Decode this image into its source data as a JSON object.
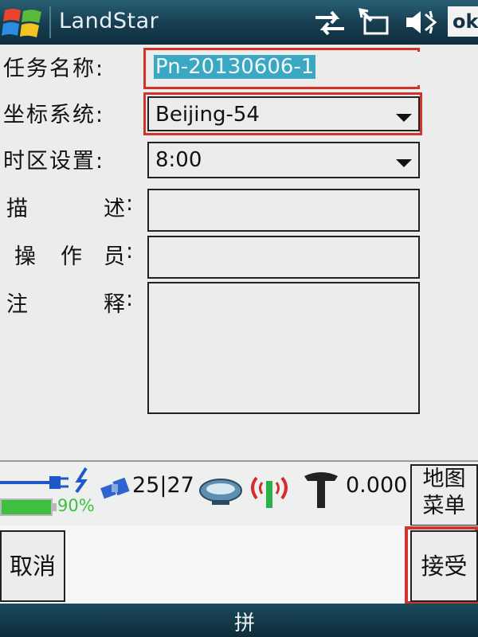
{
  "titlebar": {
    "title": "LandStar",
    "ok_label": "ok",
    "icons": [
      "windows-logo-icon",
      "connectivity-icon",
      "sync-icon",
      "volume-icon"
    ]
  },
  "form": {
    "task_name": {
      "label_chars": [
        "任",
        "务",
        "名",
        "称",
        ":"
      ],
      "value": "Pn-20130606-1"
    },
    "coord_system": {
      "label_chars": [
        "坐",
        "标",
        "系",
        "统",
        ":"
      ],
      "value": "Beijing-54"
    },
    "timezone": {
      "label_chars": [
        "时",
        "区",
        "设",
        "置",
        ":"
      ],
      "value": "8:00"
    },
    "description": {
      "label_chars": [
        "描",
        "述",
        ":"
      ],
      "value": ""
    },
    "operator": {
      "label_chars": [
        "操",
        "作",
        "员",
        ":"
      ],
      "value": ""
    },
    "notes": {
      "label_chars": [
        "注",
        "释",
        ":"
      ],
      "value": ""
    }
  },
  "status": {
    "battery_percent": "90%",
    "satellites": "25|27",
    "precision": "0.000",
    "map_menu_line1": "地图",
    "map_menu_line2": "菜单"
  },
  "buttons": {
    "cancel": "取消",
    "accept": "接受"
  },
  "bottombar": {
    "ime": "拼"
  },
  "colors": {
    "highlight": "#d0352b",
    "selection": "#3aa7c3",
    "titlebar": "#1a4a5e",
    "battery": "#3fbf3f"
  }
}
